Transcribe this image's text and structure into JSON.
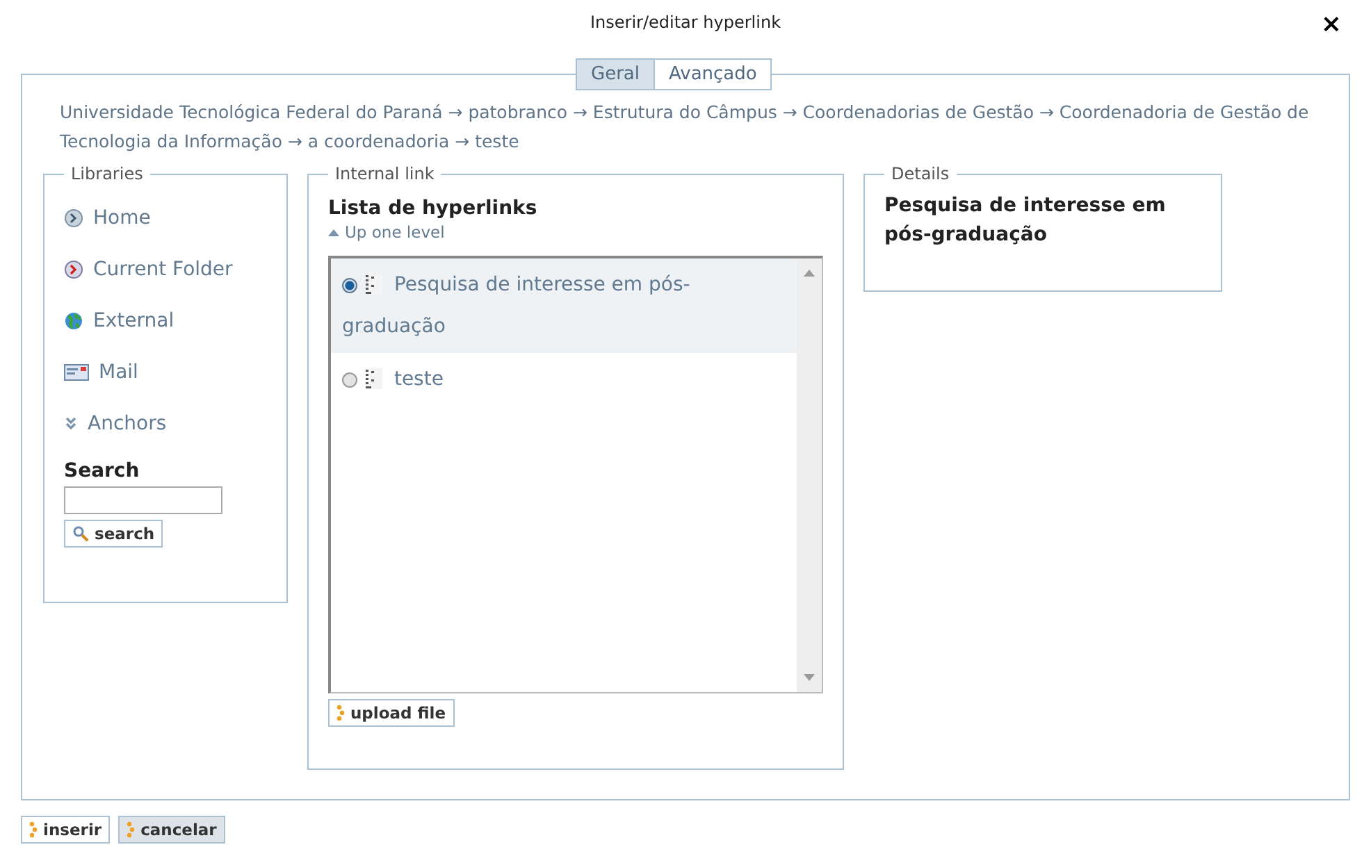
{
  "window": {
    "title": "Inserir/editar hyperlink",
    "close": "×"
  },
  "tabs": [
    {
      "label": "Geral",
      "selected": true
    },
    {
      "label": "Avançado",
      "selected": false
    }
  ],
  "breadcrumb": "Universidade Tecnológica Federal do Paraná → patobranco → Estrutura do Câmpus → Coordenadorias de Gestão → Coordenadoria de Gestão de Tecnologia da Informação → a coordenadoria → teste",
  "libraries": {
    "legend": "Libraries",
    "items": [
      {
        "label": "Home"
      },
      {
        "label": "Current Folder"
      },
      {
        "label": "External"
      },
      {
        "label": "Mail"
      },
      {
        "label": "Anchors"
      }
    ],
    "search_heading": "Search",
    "search_button": "search"
  },
  "internal_link": {
    "legend": "Internal link",
    "heading": "Lista de hyperlinks",
    "up": "Up one level",
    "items": [
      {
        "label": "Pesquisa de interesse em pós-graduação",
        "selected": true
      },
      {
        "label": "teste",
        "selected": false
      }
    ],
    "upload_button": "upload file"
  },
  "details": {
    "legend": "Details",
    "text": "Pesquisa de interesse em pós-graduação"
  },
  "buttons": [
    "inserir",
    "cancelar"
  ]
}
